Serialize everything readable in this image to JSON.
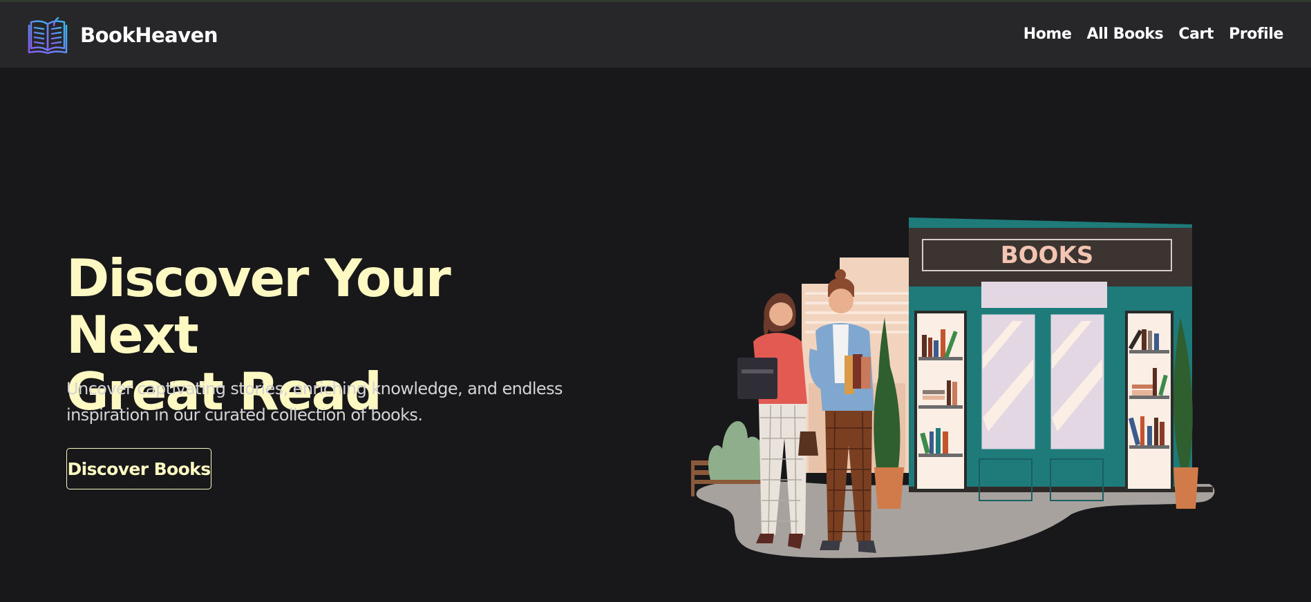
{
  "navbar": {
    "brand_name": "BookHeaven",
    "logo_icon": "open-book-icon",
    "links": [
      "Home",
      "All Books",
      "Cart",
      "Profile"
    ]
  },
  "hero": {
    "title_line1": "Discover Your Next",
    "title_line2": "Great Read",
    "subtitle": "Uncover captivating stories, enriching knowledge, and endless inspiration in our curated collection of books.",
    "cta_label": "Discover Books"
  },
  "illustration": {
    "store_sign": "BOOKS"
  },
  "colors": {
    "background": "#18181b",
    "navbar": "#27272a",
    "accent_yellow": "#fef9c3",
    "store_teal": "#1f7a7a"
  }
}
